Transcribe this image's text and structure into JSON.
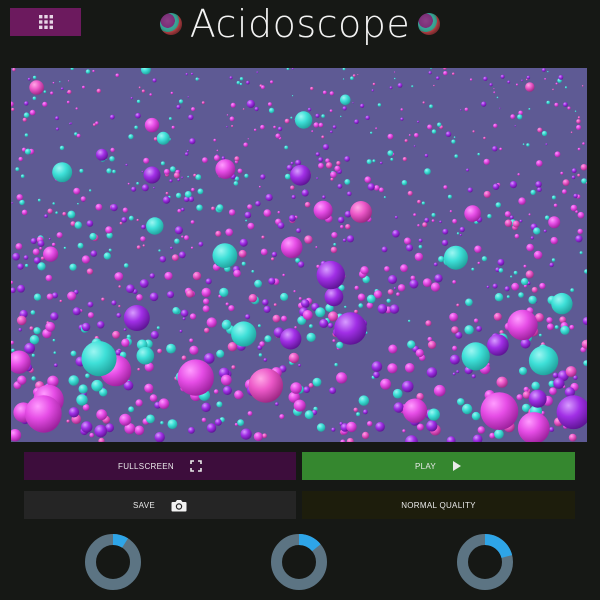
{
  "header": {
    "title": "Acidoscope",
    "menu_icon": "grid-icon",
    "logo_icon": "orb-icon"
  },
  "controls": {
    "fullscreen_label": "FULLSCREEN",
    "fullscreen_icon": "expand-icon",
    "play_label": "PLAY",
    "play_icon": "play-icon",
    "save_label": "SAVE",
    "save_icon": "camera-icon",
    "quality_label": "NORMAL QUALITY"
  },
  "gauges": [
    {
      "name": "gauge-1",
      "value": 0.09
    },
    {
      "name": "gauge-2",
      "value": 0.14
    },
    {
      "name": "gauge-3",
      "value": 0.21
    }
  ],
  "colors": {
    "background": "#161815",
    "accent_purple": "#6c1a5e",
    "play_green": "#35872f",
    "gauge_ring": "#5c7483",
    "gauge_fill": "#2ea5e8",
    "sphere_cyan": "#3ee0d8",
    "sphere_magenta": "#e64de6",
    "sphere_violet": "#a12fe6",
    "scene_bg": "#5e5a94"
  }
}
